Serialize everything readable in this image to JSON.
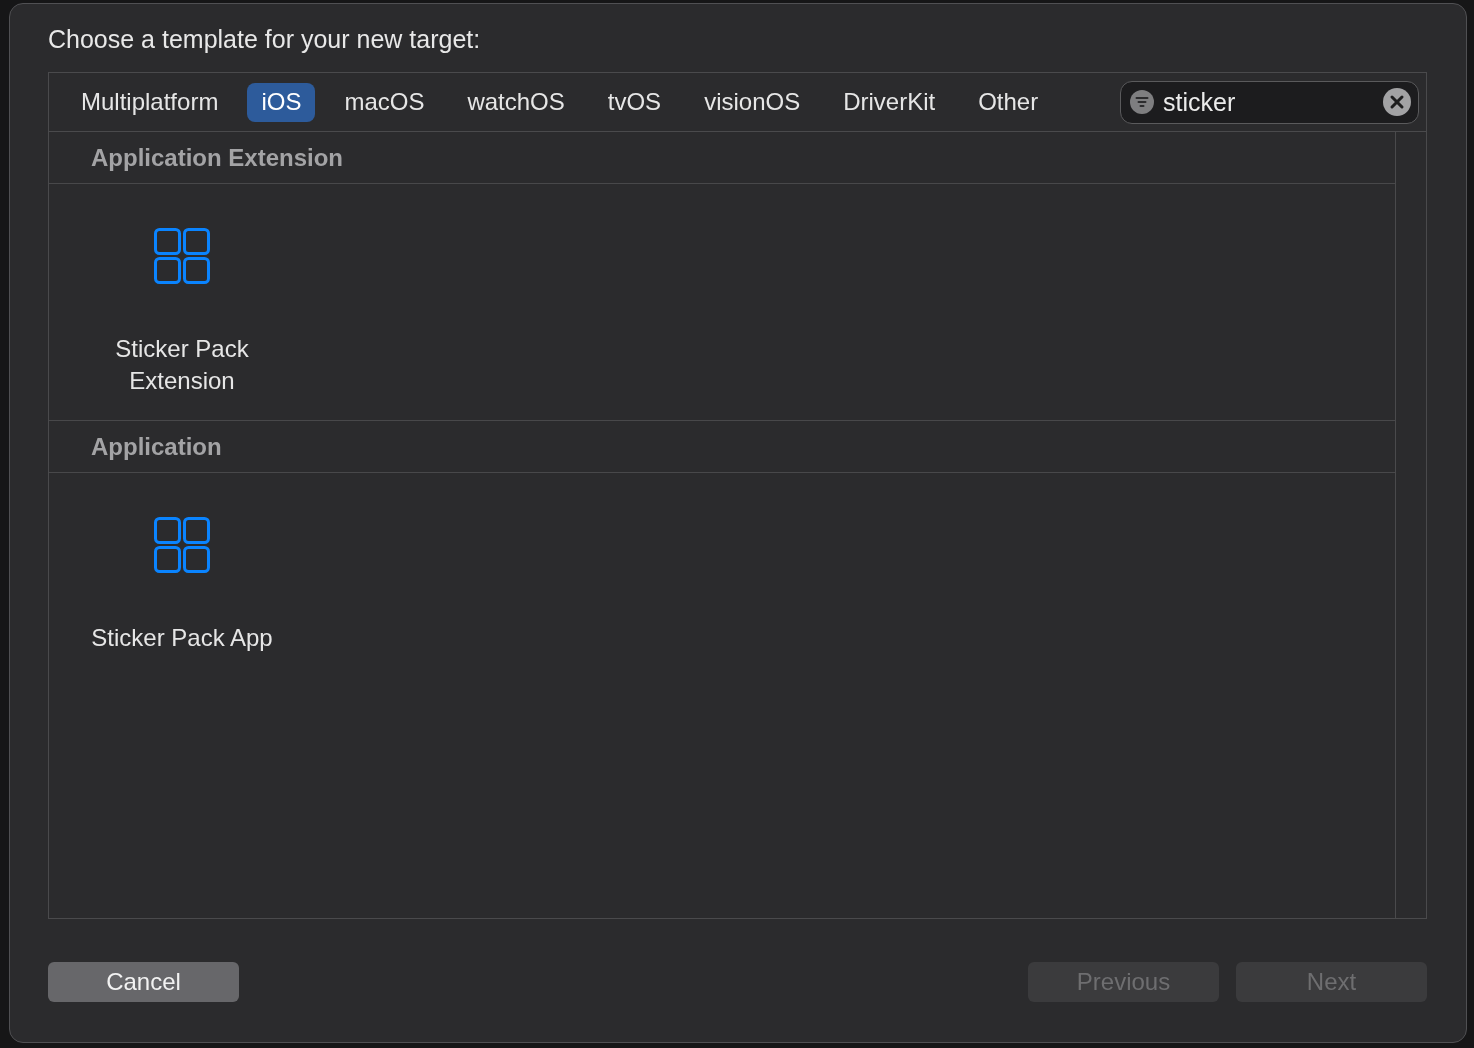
{
  "dialog": {
    "title": "Choose a template for your new target:"
  },
  "tabs": [
    {
      "label": "Multiplatform",
      "selected": false
    },
    {
      "label": "iOS",
      "selected": true
    },
    {
      "label": "macOS",
      "selected": false
    },
    {
      "label": "watchOS",
      "selected": false
    },
    {
      "label": "tvOS",
      "selected": false
    },
    {
      "label": "visionOS",
      "selected": false
    },
    {
      "label": "DriverKit",
      "selected": false
    },
    {
      "label": "Other",
      "selected": false
    }
  ],
  "search": {
    "value": "sticker"
  },
  "sections": [
    {
      "title": "Application Extension",
      "templates": [
        {
          "name": "Sticker Pack Extension",
          "selected": false
        }
      ]
    },
    {
      "title": "Application",
      "templates": [
        {
          "name": "Sticker Pack App",
          "selected": false
        }
      ]
    }
  ],
  "footer": {
    "left_buttons": [
      {
        "label": "Cancel",
        "disabled": false
      }
    ],
    "right_buttons": [
      {
        "label": "Previous",
        "disabled": true
      },
      {
        "label": "Next",
        "disabled": true
      }
    ]
  }
}
